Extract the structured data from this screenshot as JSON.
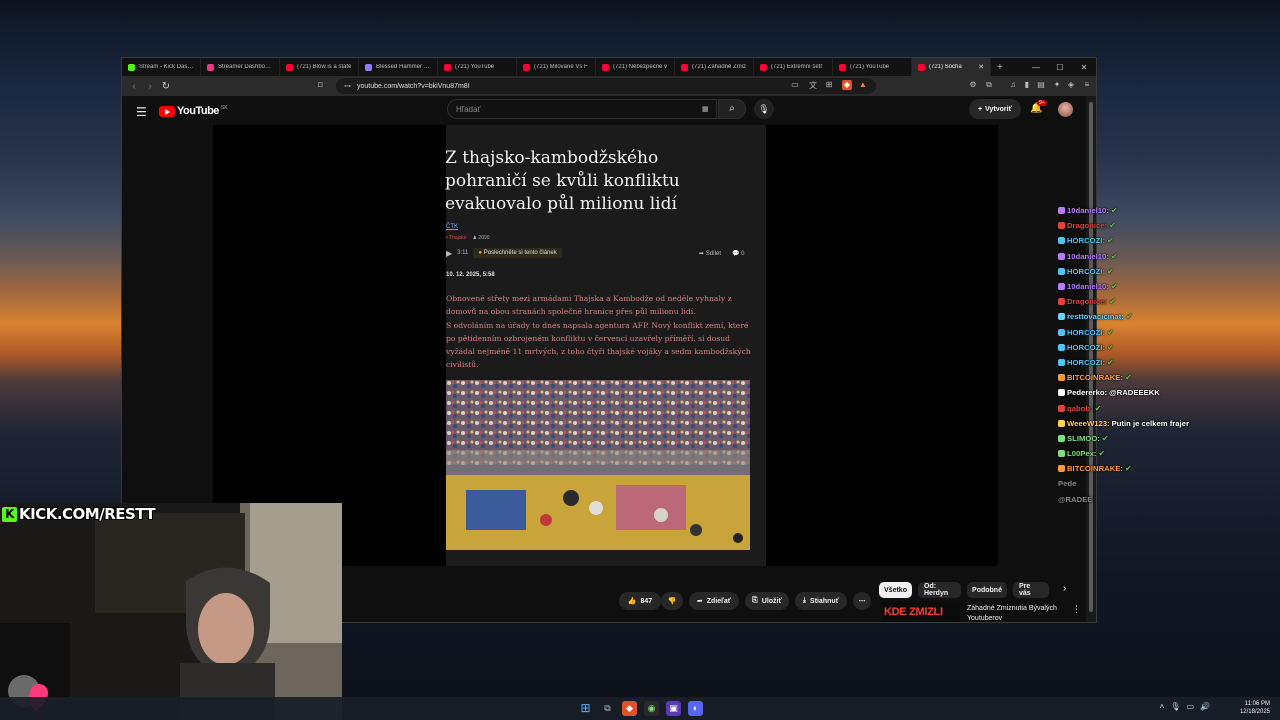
{
  "browser": {
    "tabs": [
      {
        "title": "Stream - Kick Dashb",
        "color": "#53fc18"
      },
      {
        "title": "Streamer Dashboard",
        "color": "#e53980"
      },
      {
        "title": "(721) Blow is a state",
        "color": "#ff0033"
      },
      {
        "title": "Blessed Hammer - H",
        "color": "#8a7cff"
      },
      {
        "title": "(721) YouTube",
        "color": "#ff0033"
      },
      {
        "title": "(721) Milované Vs F",
        "color": "#ff0033"
      },
      {
        "title": "(721) Nebezpečné v",
        "color": "#ff0033"
      },
      {
        "title": "(721) Záhadné Zmiz",
        "color": "#ff0033"
      },
      {
        "title": "(721) Extrémní šetř",
        "color": "#ff0033"
      },
      {
        "title": "(721) YouTube",
        "color": "#ff0033"
      },
      {
        "title": "(721) Socha",
        "color": "#ff0033",
        "active": true
      }
    ],
    "url": "youtube.com/watch?v=bkiVnu87m8I"
  },
  "youtube": {
    "logo": "YouTube",
    "country": "SK",
    "search_placeholder": "Hľadať",
    "create_label": "Vytvoriť",
    "notif_count": "9+"
  },
  "article": {
    "title": "Z thajsko-kambodžského pohraničí se kvůli konfliktu evakuovalo půl milionu lidí",
    "source": "ČTK",
    "tag": "• Thajsko",
    "views": "♟ 2090",
    "duration": "3:11",
    "listen_label": "Poslechněte si tento článek",
    "share_label": "Sdílet",
    "comments": "0",
    "date": "10. 12. 2025, 5:58",
    "paragraphs": [
      "Obnovené střety mezi armádami Thajska a Kambodže od neděle vyhnaly z domovů na obou stranách společné hranice přes půl milionu lidí.",
      "S odvoláním na úřady to dnes napsala agentura AFP. Nový konflikt zemí, které po pětidenním ozbrojeném konfliktu v červenci uzavřely příměří, si dosud vyžádal nejméně 11 mrtvých, z toho čtyři thajské vojáky a sedm kambodžských civilistů."
    ]
  },
  "actions": {
    "likes": "847",
    "share": "Zdieľať",
    "save": "Uložiť",
    "download": "Stiahnuť",
    "more": "⋯"
  },
  "chips": [
    "Všetko",
    "Od: Herdyn",
    "Podobné",
    "Pre vás"
  ],
  "recommended": {
    "thumb_text": "KDE ZMIZLI",
    "title": "Záhadné Zmiznutia Bývalých Youtuberov"
  },
  "chat": [
    {
      "user": "10daniel10:",
      "color": "#b57cff",
      "text": ""
    },
    {
      "user": "Dragonice:",
      "color": "#e0433a",
      "text": ""
    },
    {
      "user": "HORCOZI:",
      "color": "#4fc3f7",
      "text": ""
    },
    {
      "user": "10daniel10:",
      "color": "#b57cff",
      "text": ""
    },
    {
      "user": "HORCOZI:",
      "color": "#4fc3f7",
      "text": ""
    },
    {
      "user": "10daniel10:",
      "color": "#b57cff",
      "text": ""
    },
    {
      "user": "Dragonice:",
      "color": "#e0433a",
      "text": ""
    },
    {
      "user": "resttovacicinat:",
      "color": "#66d4ff",
      "text": ""
    },
    {
      "user": "HORCOZI:",
      "color": "#4fc3f7",
      "text": ""
    },
    {
      "user": "HORCOZI:",
      "color": "#4fc3f7",
      "text": ""
    },
    {
      "user": "HORCOZI:",
      "color": "#4fc3f7",
      "text": ""
    },
    {
      "user": "BITCOINRAKE:",
      "color": "#ff9a3c",
      "text": ""
    },
    {
      "user": "Pedererko:",
      "color": "#ffffff",
      "text": "@RADEEEKK"
    },
    {
      "user": "qabob:",
      "color": "#e0433a",
      "text": ""
    },
    {
      "user": "WeeeW123:",
      "color": "#ffd24a",
      "text": "Putin je celkem frajer"
    },
    {
      "user": "SLIMOO:",
      "color": "#7fe07f",
      "text": ""
    },
    {
      "user": "L00Pex:",
      "color": "#7fe07f",
      "text": ""
    },
    {
      "user": "BITCOINRAKE:",
      "color": "#ff9a3c",
      "text": ""
    },
    {
      "user": "Pede",
      "color": "#888888",
      "text": ""
    },
    {
      "user": "@RADEE",
      "color": "#888888",
      "text": ""
    }
  ],
  "stream": {
    "kick_url": "KICK.COM/RESTT"
  },
  "taskbar": {
    "time": "11:06 PM",
    "date": "12/18/2025"
  }
}
